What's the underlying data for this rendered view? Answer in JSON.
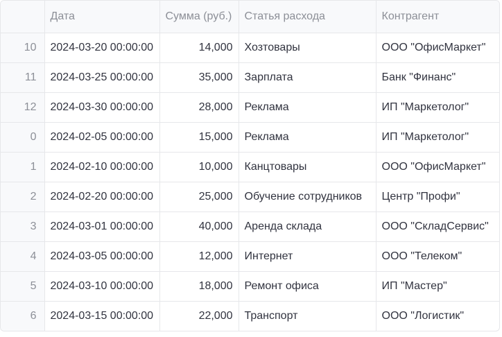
{
  "table": {
    "headers": [
      "",
      "Дата",
      "Сумма (руб.)",
      "Статья расхода",
      "Контрагент"
    ],
    "rows": [
      {
        "index": "10",
        "date": "2024-03-20 00:00:00",
        "amount": "14,000",
        "category": "Хозтовары",
        "counterparty": "ООО \"ОфисМаркет\""
      },
      {
        "index": "11",
        "date": "2024-03-25 00:00:00",
        "amount": "35,000",
        "category": "Зарплата",
        "counterparty": "Банк \"Финанс\""
      },
      {
        "index": "12",
        "date": "2024-03-30 00:00:00",
        "amount": "28,000",
        "category": "Реклама",
        "counterparty": "ИП \"Маркетолог\""
      },
      {
        "index": "0",
        "date": "2024-02-05 00:00:00",
        "amount": "15,000",
        "category": "Реклама",
        "counterparty": "ИП \"Маркетолог\""
      },
      {
        "index": "1",
        "date": "2024-02-10 00:00:00",
        "amount": "10,000",
        "category": "Канцтовары",
        "counterparty": "ООО \"ОфисМаркет\""
      },
      {
        "index": "2",
        "date": "2024-02-20 00:00:00",
        "amount": "25,000",
        "category": "Обучение сотрудников",
        "counterparty": "Центр \"Профи\""
      },
      {
        "index": "3",
        "date": "2024-03-01 00:00:00",
        "amount": "40,000",
        "category": "Аренда склада",
        "counterparty": "ООО \"СкладСервис\""
      },
      {
        "index": "4",
        "date": "2024-03-05 00:00:00",
        "amount": "12,000",
        "category": "Интернет",
        "counterparty": "ООО \"Телеком\""
      },
      {
        "index": "5",
        "date": "2024-03-10 00:00:00",
        "amount": "18,000",
        "category": "Ремонт офиса",
        "counterparty": "ИП \"Мастер\""
      },
      {
        "index": "6",
        "date": "2024-03-15 00:00:00",
        "amount": "22,000",
        "category": "Транспорт",
        "counterparty": "ООО \"Логистик\""
      }
    ]
  }
}
